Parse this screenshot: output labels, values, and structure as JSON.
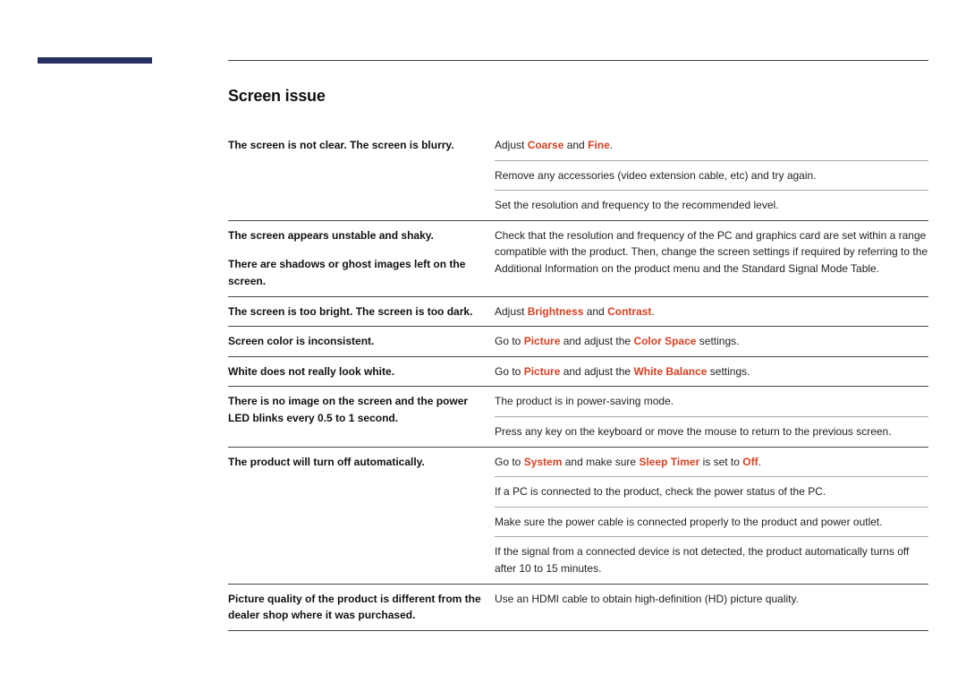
{
  "section_title": "Screen issue",
  "rows": {
    "r1": {
      "issue": "The screen is not clear. The screen is blurry.",
      "sol1": {
        "pre": "Adjust ",
        "hl1": "Coarse",
        "mid": " and ",
        "hl2": "Fine",
        "post": "."
      },
      "sol2": "Remove any accessories (video extension cable, etc) and try again.",
      "sol3": "Set the resolution and frequency to the recommended level."
    },
    "r2": {
      "issue1": "The screen appears unstable and shaky.",
      "issue2": "There are shadows or ghost images left on the screen.",
      "sol": "Check that the resolution and frequency of the PC and graphics card are set within a range compatible with the product. Then, change the screen settings if required by referring to the Additional Information on the product menu and the Standard Signal Mode Table."
    },
    "r3": {
      "issue": "The screen is too bright. The screen is too dark.",
      "sol": {
        "pre": "Adjust ",
        "hl1": "Brightness",
        "mid": " and ",
        "hl2": "Contrast",
        "post": "."
      }
    },
    "r4": {
      "issue": "Screen color is inconsistent.",
      "sol": {
        "pre": "Go to ",
        "hl1": "Picture",
        "mid": " and adjust the ",
        "hl2": "Color Space",
        "post": " settings."
      }
    },
    "r5": {
      "issue": "White does not really look white.",
      "sol": {
        "pre": "Go to ",
        "hl1": "Picture",
        "mid": " and adjust the ",
        "hl2": "White Balance",
        "post": " settings."
      }
    },
    "r6": {
      "issue": "There is no image on the screen and the power LED blinks every 0.5 to 1 second.",
      "sol1": "The product is in power-saving mode.",
      "sol2": "Press any key on the keyboard or move the mouse to return to the previous screen."
    },
    "r7": {
      "issue": "The product will turn off automatically.",
      "sol1": {
        "pre": "Go to ",
        "hl1": "System",
        "mid": " and make sure ",
        "hl2": "Sleep Timer",
        "mid2": " is set to ",
        "hl3": "Off",
        "post": "."
      },
      "sol2": "If a PC is connected to the product, check the power status of the PC.",
      "sol3": "Make sure the power cable is connected properly to the product and power outlet.",
      "sol4": "If the signal from a connected device is not detected, the product automatically turns off after 10 to 15 minutes."
    },
    "r8": {
      "issue": "Picture quality of the product is different from the dealer shop where it was purchased.",
      "sol": "Use an HDMI cable to obtain high-definition (HD) picture quality."
    }
  }
}
